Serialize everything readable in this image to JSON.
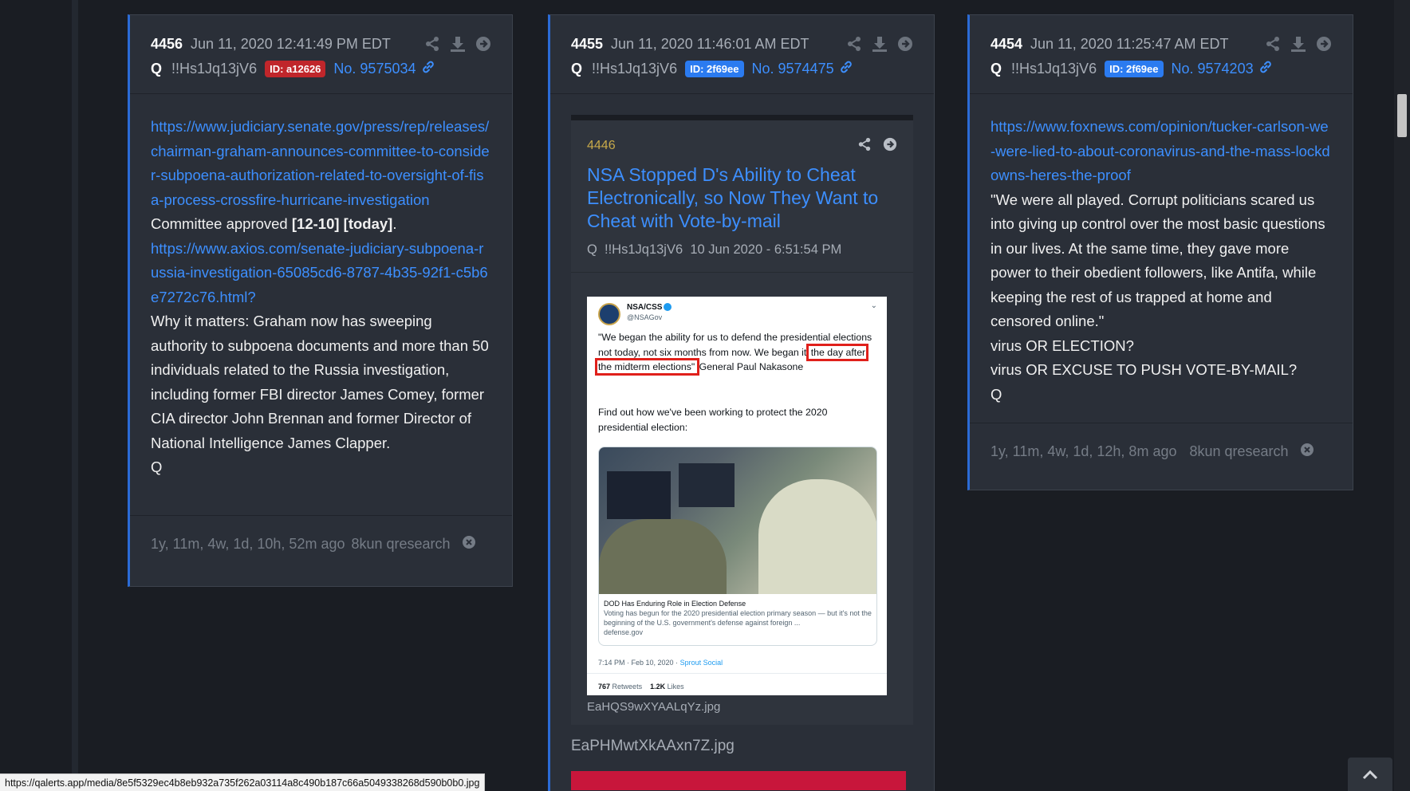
{
  "posts": [
    {
      "number": "4456",
      "timestamp": "Jun 11, 2020 12:41:49 PM EDT",
      "author": "Q",
      "tripcode": "!!Hs1Jq13jV6",
      "id_badge": "ID: a12626",
      "id_color": "#c0262b",
      "post_no": "No. 9575034",
      "link1": "https://www.judiciary.senate.gov/press/rep/releases/chairman-graham-announces-committee-to-consider-subpoena-authorization-related-to-oversight-of-fisa-process-crossfire-hurricane-investigation",
      "line_committee_prefix": "Committee approved ",
      "line_committee_bold": "[12-10] [today]",
      "line_committee_suffix": ".",
      "link2": "https://www.axios.com/senate-judiciary-subpoena-russia-investigation-65085cd6-8787-4b35-92f1-c5b6e7272c76.html?",
      "paragraph": "Why it matters: Graham now has sweeping authority to subpoena documents and more than 50 individuals related to the Russia investigation, including former FBI director James Comey, former CIA director John Brennan and former Director of National Intelligence James Clapper.",
      "signature": "Q",
      "age": "1y, 11m, 4w, 1d, 10h, 52m ago",
      "source": "8kun qresearch"
    },
    {
      "number": "4455",
      "timestamp": "Jun 11, 2020 11:46:01 AM EDT",
      "author": "Q",
      "tripcode": "!!Hs1Jq13jV6",
      "id_badge": "ID: 2f69ee",
      "id_color": "#2b7bf0",
      "post_no": "No. 9574475",
      "quote": {
        "number": "4446",
        "title": "NSA Stopped D's Ability to Cheat Electronically, so Now They Want to Cheat with Vote-by-mail",
        "author": "Q",
        "tripcode": "!!Hs1Jq13jV6",
        "date": "10 Jun 2020 - 6:51:54 PM",
        "image_filename": "EaHQS9wXYAALqYz.jpg"
      },
      "tweet": {
        "account_name": "NSA/CSS",
        "handle": "@NSAGov",
        "text_before": "\"We began the ability for us to defend the presidential elections not today, not six months from now. We began it",
        "highlight": "the day after the midterm elections\"",
        "text_after": " General Paul Nakasone",
        "text2": "Find out how we've been working to protect the 2020 presidential election:",
        "card_title": "DOD Has Enduring Role in Election Defense",
        "card_desc": "Voting has begun for the 2020 presidential election primary season — but it's not the beginning of the U.S. government's defense against foreign ...",
        "card_domain": "defense.gov",
        "time": "7:14 PM · Feb 10, 2020 · ",
        "client": "Sprout Social",
        "retweets_num": "767",
        "retweets_label": "Retweets",
        "likes_num": "1.2K",
        "likes_label": "Likes"
      },
      "image_filename": "EaPHMwtXkAAxn7Z.jpg"
    },
    {
      "number": "4454",
      "timestamp": "Jun 11, 2020 11:25:47 AM EDT",
      "author": "Q",
      "tripcode": "!!Hs1Jq13jV6",
      "id_badge": "ID: 2f69ee",
      "id_color": "#2b7bf0",
      "post_no": "No. 9574203",
      "link1": "https://www.foxnews.com/opinion/tucker-carlson-we-were-lied-to-about-coronavirus-and-the-mass-lockdowns-heres-the-proof",
      "paragraph": "\"We were all played. Corrupt politicians scared us into giving up control over the most basic questions in our lives. At the same time, they gave more power to their obedient followers, like Antifa, while keeping the rest of us trapped at home and censored online.\"",
      "line2": "virus OR ELECTION?",
      "line3": "virus OR EXCUSE TO PUSH VOTE-BY-MAIL?",
      "signature": "Q",
      "age": "1y, 11m, 4w, 1d, 12h, 8m ago",
      "source": "8kun qresearch"
    }
  ],
  "status_url": "https://qalerts.app/media/8e5f5329ec4b8eb932a735f262a03114a8c490b187c66a5049338268d590b0b0.jpg",
  "colors": {
    "accent": "#3d8fff",
    "background": "#1a1d23",
    "card": "#2a2f38",
    "quote_number": "#c7a94a"
  }
}
